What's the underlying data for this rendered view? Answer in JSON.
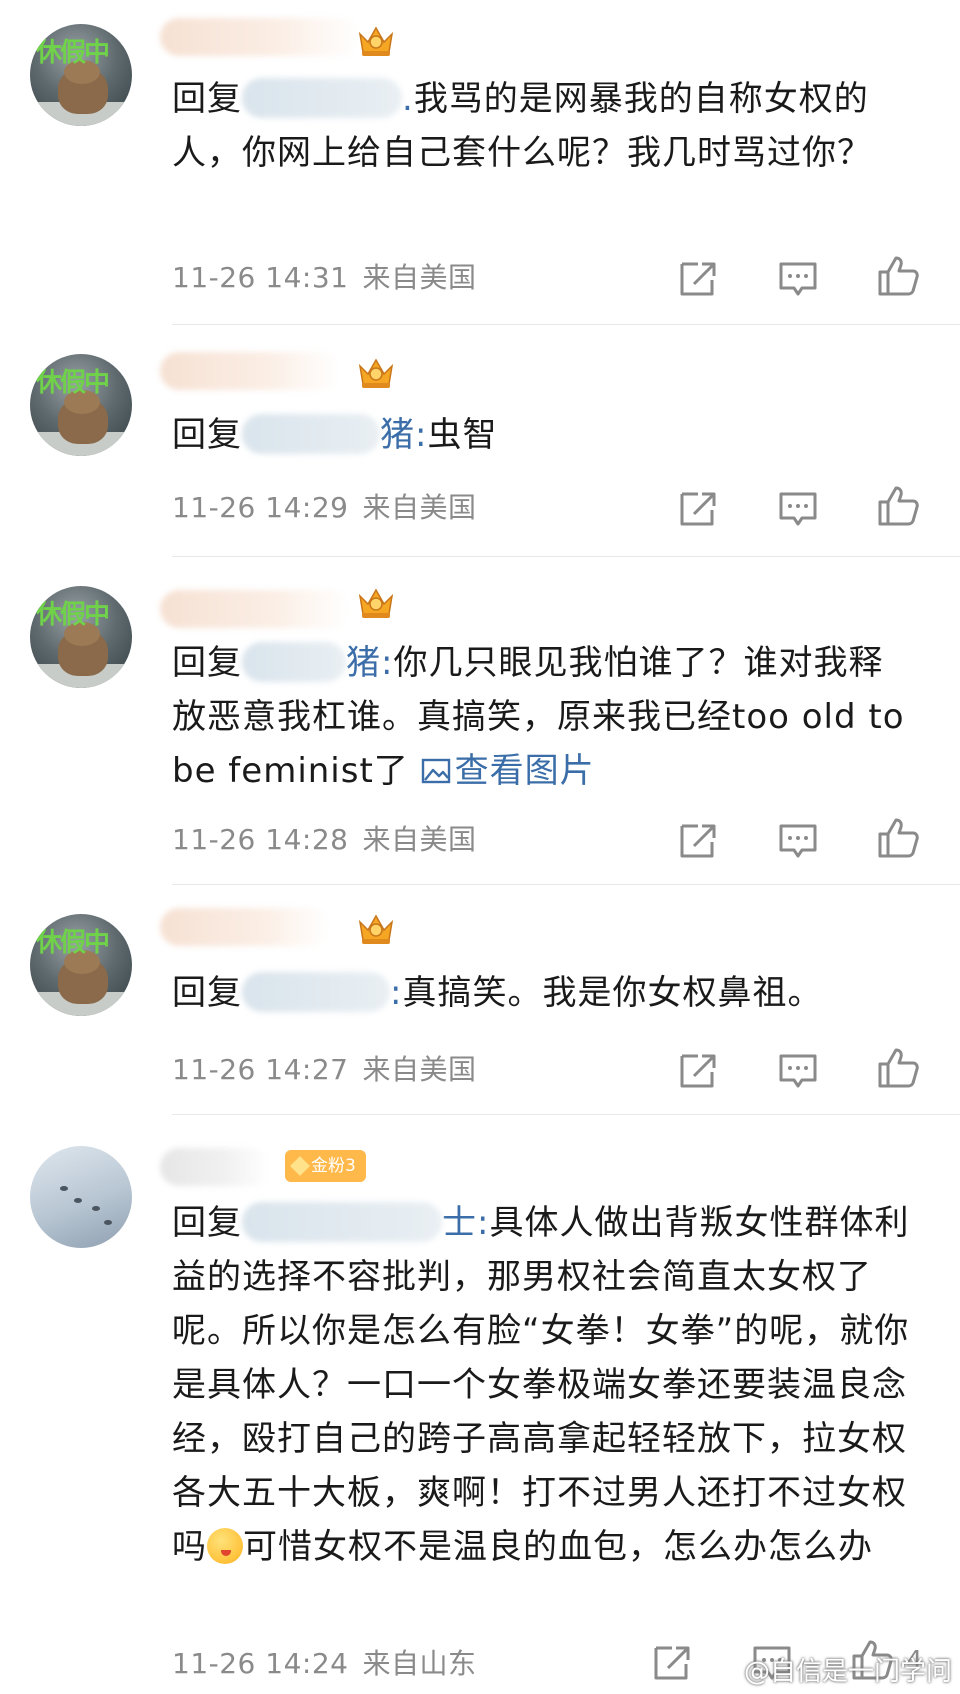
{
  "comments": [
    {
      "reply_prefix": "回复",
      "mention_tail": ".",
      "body": "我骂的是网暴我的自称女权的人，你网上给自己套什么呢？我几时骂过你？",
      "time": "11-26 14:31",
      "location": "来自美国"
    },
    {
      "reply_prefix": "回复",
      "mention_tail": "猪:",
      "body": "虫智",
      "time": "11-26 14:29",
      "location": "来自美国"
    },
    {
      "reply_prefix": "回复",
      "mention_tail": "猪:",
      "body": "你几只眼见我怕谁了？谁对我释放恶意我杠谁。真搞笑，原来我已经too old to be feminist了",
      "image_link": "查看图片",
      "time": "11-26 14:28",
      "location": "来自美国"
    },
    {
      "reply_prefix": "回复",
      "mention_tail": ":",
      "body": "真搞笑。我是你女权鼻祖。",
      "time": "11-26 14:27",
      "location": "来自美国"
    },
    {
      "badge": "金粉3",
      "reply_prefix": "回复",
      "mention_tail": "士:",
      "body": "具体人做出背叛女性群体利益的选择不容批判，那男权社会简直太女权了呢。所以你是怎么有脸“女拳！女拳”的呢，就你是具体人？一口一个女拳极端女拳还要装温良念经，殴打自己的跨子高高拿起轻轻放下，拉女权各大五十大板，爽啊！打不过男人还打不过女权吗",
      "body_after_emoji": "可惜女权不是温良的血包，怎么办怎么办",
      "time": "11-26 14:24",
      "location": "来自山东",
      "like_count": "4"
    }
  ],
  "watermark": "@自信是一门学问",
  "colors": {
    "link": "#3b6ea8",
    "meta": "#8a8a8a",
    "badge": "#ffb84a"
  }
}
